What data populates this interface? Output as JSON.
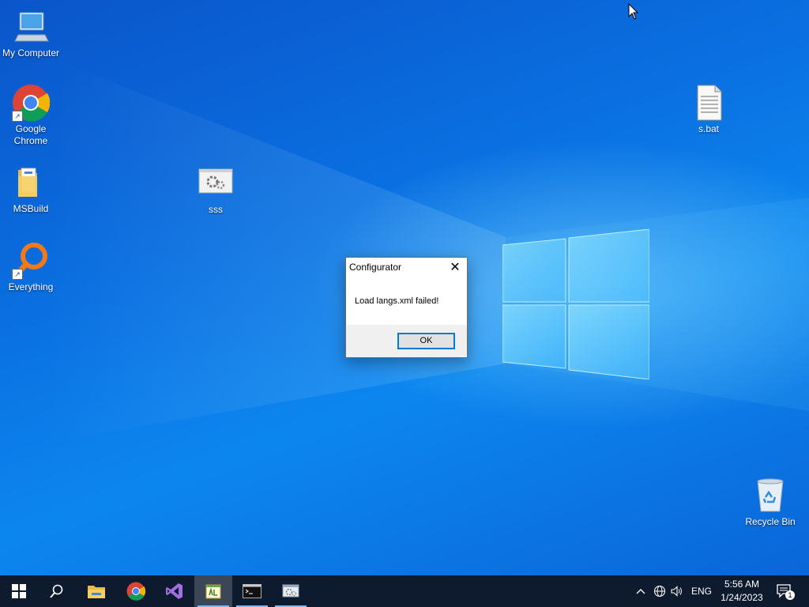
{
  "desktop": {
    "icons": [
      {
        "name": "my-computer",
        "label": "My Computer",
        "icon": "computer-icon"
      },
      {
        "name": "google-chrome",
        "label": "Google Chrome",
        "icon": "chrome-icon"
      },
      {
        "name": "msbuild",
        "label": "MSBuild",
        "icon": "folder-icon"
      },
      {
        "name": "everything",
        "label": "Everything",
        "icon": "magnifier-icon"
      },
      {
        "name": "sss",
        "label": "sss",
        "icon": "settings-app-icon"
      },
      {
        "name": "s-bat",
        "label": "s.bat",
        "icon": "batch-file-icon"
      },
      {
        "name": "recycle-bin",
        "label": "Recycle Bin",
        "icon": "recycle-bin-icon"
      }
    ]
  },
  "dialog": {
    "title": "Configurator",
    "close_glyph": "✕",
    "message": "Load langs.xml failed!",
    "ok_label": "OK"
  },
  "taskbar": {
    "apps": [
      {
        "name": "start",
        "icon": "windows-start-icon"
      },
      {
        "name": "search",
        "icon": "search-icon"
      },
      {
        "name": "file-explorer",
        "icon": "file-explorer-icon"
      },
      {
        "name": "chrome",
        "icon": "chrome-icon"
      },
      {
        "name": "visual-studio",
        "icon": "visual-studio-icon"
      },
      {
        "name": "configurator",
        "icon": "configurator-app-icon",
        "active": true
      },
      {
        "name": "command-prompt",
        "icon": "cmd-icon"
      },
      {
        "name": "app",
        "icon": "app-window-icon"
      }
    ],
    "tray": {
      "language": "ENG",
      "time": "5:56 AM",
      "date": "1/24/2023",
      "notifications_count": "1"
    }
  },
  "colors": {
    "taskbar_bg": "#0e1a2e",
    "accent": "#0078d7",
    "desktop_blue": "#0a6fe0"
  }
}
